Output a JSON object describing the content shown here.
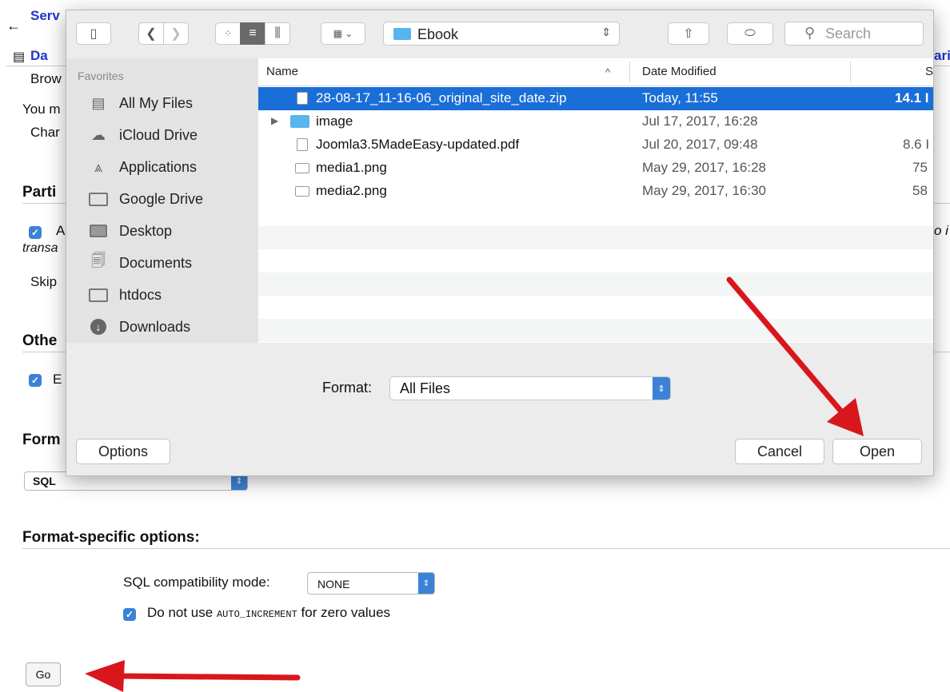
{
  "background": {
    "nav_back": "←",
    "nav_server": "Serv",
    "tab_db": "Da",
    "tab_right": "ari",
    "browse": "Brow",
    "you_must": "You m",
    "charset": "Char",
    "partial_heading": "Parti",
    "partial_checkbox": "A",
    "right_italic": "o i",
    "transa": "transa",
    "skip": "Skip",
    "other_heading": "Othe",
    "other_checkbox": "E",
    "format_heading": "Form",
    "format_select": "SQL",
    "format_specific_heading": "Format-specific options:",
    "sql_compat_label": "SQL compatibility mode:",
    "sql_compat_value": "NONE",
    "auto_inc_prefix": "Do not use",
    "auto_inc_code": "AUTO_INCREMENT",
    "auto_inc_suffix": "for zero values",
    "go_button": "Go"
  },
  "dialog": {
    "location": "Ebook",
    "search_placeholder": "Search",
    "sidebar": {
      "section": "Favorites",
      "items": [
        {
          "label": "All My Files",
          "icon": "all-files-icon"
        },
        {
          "label": "iCloud Drive",
          "icon": "cloud-icon"
        },
        {
          "label": "Applications",
          "icon": "applications-icon"
        },
        {
          "label": "Google Drive",
          "icon": "folder-icon"
        },
        {
          "label": "Desktop",
          "icon": "desktop-icon"
        },
        {
          "label": "Documents",
          "icon": "documents-icon"
        },
        {
          "label": "htdocs",
          "icon": "folder-icon"
        },
        {
          "label": "Downloads",
          "icon": "downloads-icon"
        }
      ]
    },
    "columns": {
      "name": "Name",
      "sort_glyph": "^",
      "date": "Date Modified",
      "size": "S"
    },
    "files": [
      {
        "name": "28-08-17_11-16-06_original_site_date.zip",
        "date": "Today, 11:55",
        "size": "14.1 I",
        "selected": true,
        "kind": "zip"
      },
      {
        "name": "image",
        "date": "Jul 17, 2017, 16:28",
        "size": "",
        "selected": false,
        "kind": "folder"
      },
      {
        "name": "Joomla3.5MadeEasy-updated.pdf",
        "date": "Jul 20, 2017, 09:48",
        "size": "8.6 I",
        "selected": false,
        "kind": "pdf"
      },
      {
        "name": "media1.png",
        "date": "May 29, 2017, 16:28",
        "size": "75",
        "selected": false,
        "kind": "png"
      },
      {
        "name": "media2.png",
        "date": "May 29, 2017, 16:30",
        "size": "58",
        "selected": false,
        "kind": "png"
      }
    ],
    "format_label": "Format:",
    "format_value": "All Files",
    "options_button": "Options",
    "cancel_button": "Cancel",
    "open_button": "Open"
  },
  "colors": {
    "selection": "#1a6ed8",
    "accent": "#3b82d6",
    "arrow": "#d9161c",
    "link": "#2233cc"
  }
}
